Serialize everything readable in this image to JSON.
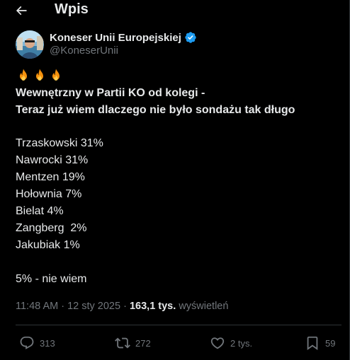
{
  "header": {
    "title": "Wpis",
    "back_icon": "arrow-left-icon"
  },
  "author": {
    "name": "Koneser Unii Europejskiej",
    "handle": "@KoneserUnii",
    "verified": true,
    "verified_color": "#1d9bf0"
  },
  "tweet": {
    "emojis": [
      "fire-icon",
      "fire-icon",
      "fire-icon"
    ],
    "headline_line1": "Wewnętrzny w Partii KO od kolegi -",
    "headline_line2": "Teraz już wiem dlaczego nie było sondażu tak długo",
    "poll_lines": [
      "Trzaskowski 31%",
      "Nawrocki 31%",
      "Mentzen 19%",
      "Hołownia 7%",
      "Bielat 4%",
      "Zangberg  2%",
      "Jakubiak 1%"
    ],
    "footer_line": "5% - nie wiem"
  },
  "meta": {
    "time": "11:48 AM",
    "separator": " · ",
    "date": "12 sty 2025",
    "views_count": "163,1 tys.",
    "views_label": "wyświetleń"
  },
  "actions": {
    "reply_count": "313",
    "retweet_count": "272",
    "like_count": "2 tys.",
    "bookmark_count": "59"
  },
  "colors": {
    "background": "#000000",
    "text": "#e7e9ea",
    "muted": "#71767b",
    "accent": "#1d9bf0",
    "border": "#2f3336"
  }
}
